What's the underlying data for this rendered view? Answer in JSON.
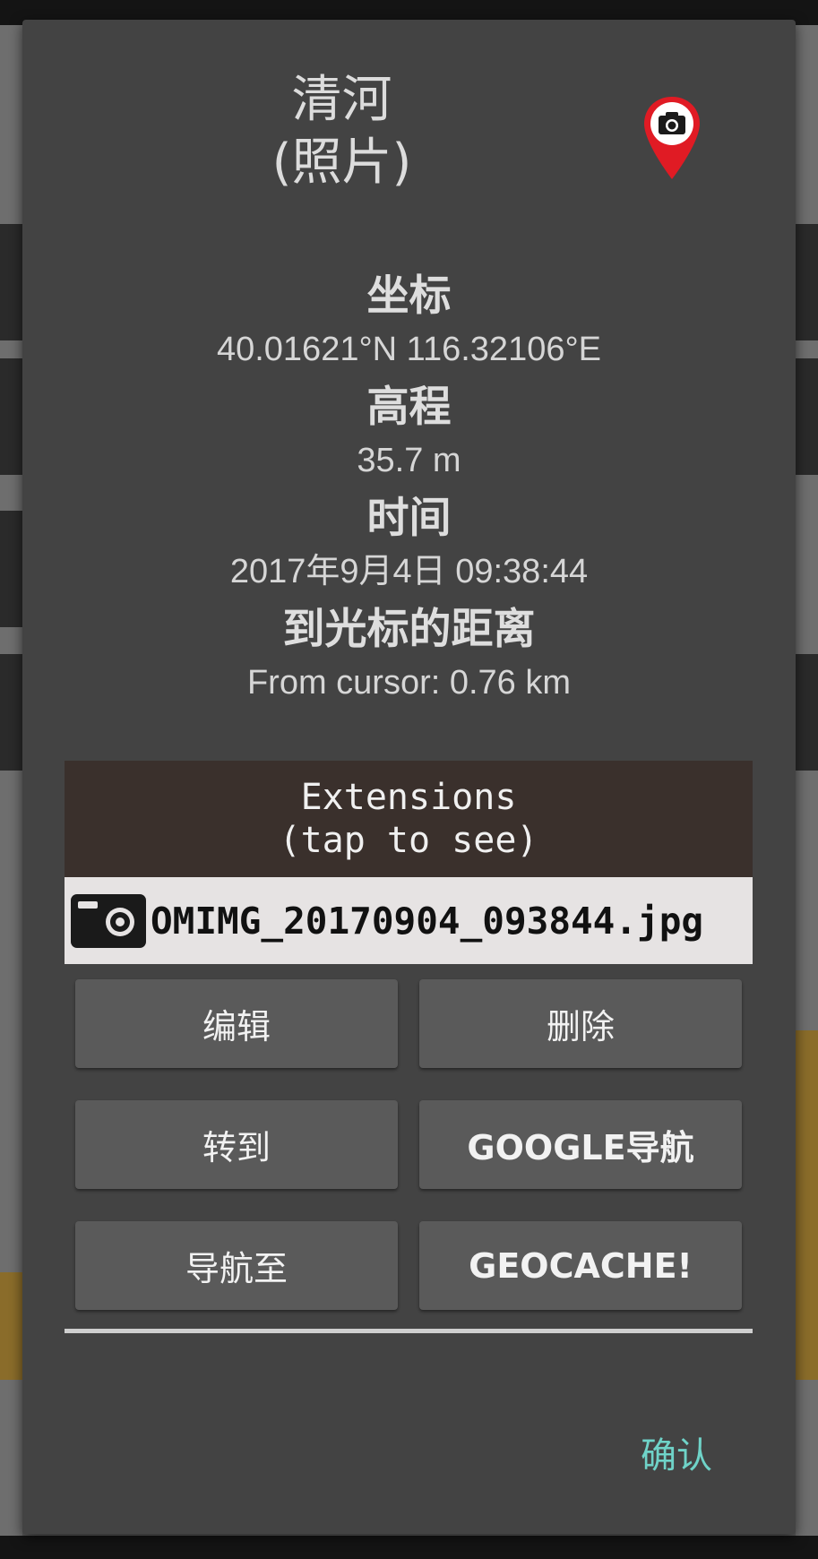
{
  "dialog": {
    "title": "清河",
    "subtitle": "(照片)",
    "pin_icon": "camera-pin-icon",
    "fields": [
      {
        "label": "坐标",
        "value": "40.01621°N 116.32106°E"
      },
      {
        "label": "高程",
        "value": "35.7 m"
      },
      {
        "label": "时间",
        "value": "2017年9月4日 09:38:44"
      },
      {
        "label": "到光标的距离",
        "value": "From cursor: 0.76 km"
      }
    ],
    "extensions": {
      "line1": "Extensions",
      "line2": "(tap to see)"
    },
    "attachment": {
      "icon": "camera-icon",
      "filename": "OMIMG_20170904_093844.jpg"
    },
    "buttons": {
      "edit": "编辑",
      "delete": "删除",
      "goto": "转到",
      "google_nav": "GOOGLE导航",
      "navigate_to": "导航至",
      "geocache": "GEOCACHE!"
    },
    "confirm": "确认"
  },
  "colors": {
    "dialog_bg": "#434343",
    "button_bg": "#5a5a5a",
    "extensions_bg": "#3a302c",
    "attachment_bg": "#e6e3e3",
    "accent": "#6fd3c8",
    "pin_red": "#e01b24"
  }
}
